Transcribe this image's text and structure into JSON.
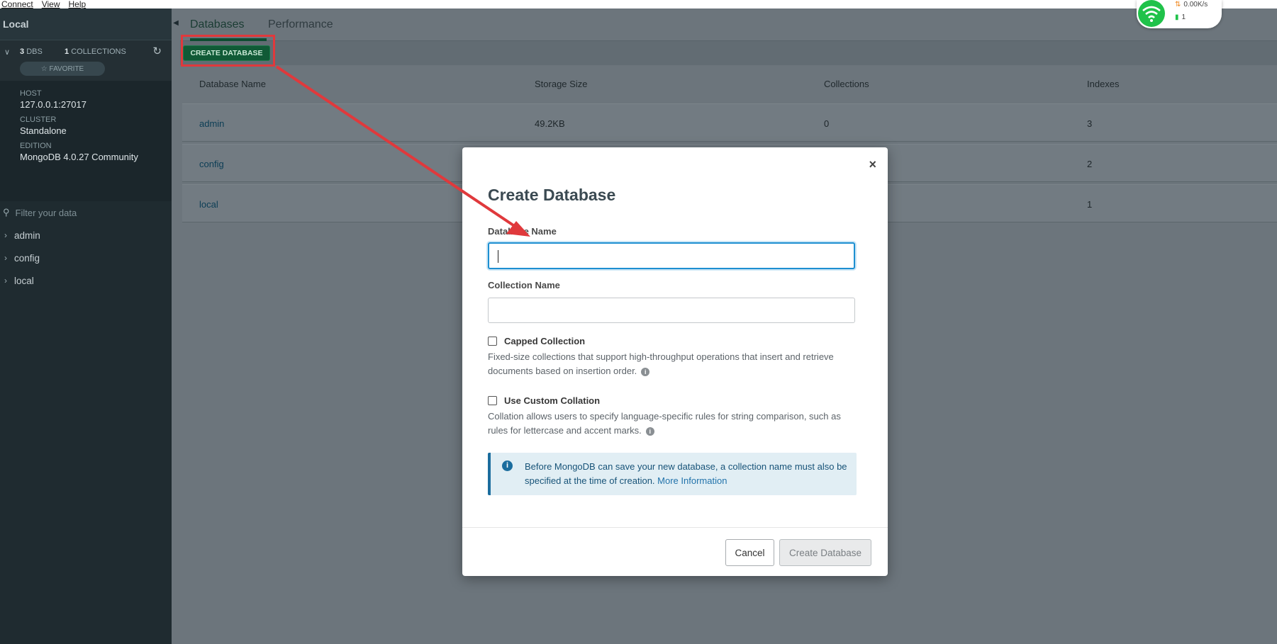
{
  "menubar": {
    "items": [
      "Connect",
      "View",
      "Help"
    ]
  },
  "sidebar": {
    "title": "Local",
    "dbs_count": "3",
    "dbs_label": "DBS",
    "collections_count": "1",
    "collections_label": "COLLECTIONS",
    "favorite_label": "☆ FAVORITE",
    "host_label": "HOST",
    "host_value": "127.0.0.1:27017",
    "cluster_label": "CLUSTER",
    "cluster_value": "Standalone",
    "edition_label": "EDITION",
    "edition_value": "MongoDB 4.0.27 Community",
    "filter_placeholder": "Filter your data",
    "items": [
      {
        "label": "admin"
      },
      {
        "label": "config"
      },
      {
        "label": "local"
      }
    ]
  },
  "tabs": [
    {
      "label": "Databases"
    },
    {
      "label": "Performance"
    }
  ],
  "toolbar": {
    "create_label": "CREATE DATABASE"
  },
  "table": {
    "headers": [
      "Database Name",
      "Storage Size",
      "Collections",
      "Indexes"
    ],
    "rows": [
      {
        "name": "admin",
        "storage": "49.2KB",
        "collections": "0",
        "indexes": "3"
      },
      {
        "name": "config",
        "storage": "",
        "collections": "",
        "indexes": "2"
      },
      {
        "name": "local",
        "storage": "",
        "collections": "",
        "indexes": "1"
      }
    ]
  },
  "modal": {
    "title": "Create Database",
    "close_symbol": "×",
    "db_name_label": "Database Name",
    "collection_name_label": "Collection Name",
    "capped_label": "Capped Collection",
    "capped_help": "Fixed-size collections that support high-throughput operations that insert and retrieve documents based on insertion order.",
    "collation_label": "Use Custom Collation",
    "collation_help": "Collation allows users to specify language-specific rules for string comparison, such as rules for lettercase and accent marks.",
    "info_text": "Before MongoDB can save your new database, a collection name must also be specified at the time of creation.",
    "info_link": "More Information",
    "cancel_label": "Cancel",
    "create_label": "Create Database"
  },
  "network": {
    "up_speed": "0.00K/s",
    "down_count": "1"
  },
  "colors": {
    "accent_green": "#105a36",
    "annotation_red": "#e0393c",
    "focus_blue": "#1d8fd1"
  }
}
